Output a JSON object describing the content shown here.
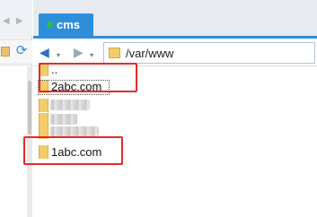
{
  "left_pane": {
    "folder_icon": "folder-icon",
    "refresh_icon": "refresh-icon",
    "refresh_glyph": "⟳"
  },
  "tab": {
    "label": "cms",
    "status_color": "#2fbf3e",
    "accent_color": "#2d8fdc"
  },
  "nav": {
    "back_glyph": "◀",
    "forward_glyph": "▶",
    "dropdown_glyph": "▾",
    "path": "/var/www"
  },
  "files": [
    {
      "name": "..",
      "icon": "folder-icon"
    },
    {
      "name": "2abc.com",
      "icon": "folder-icon"
    },
    {
      "name": "",
      "icon": "folder-icon"
    },
    {
      "name": "",
      "icon": "folder-icon"
    },
    {
      "name": "",
      "icon": "folder-icon"
    },
    {
      "name": "1abc.com",
      "icon": "folder-icon"
    }
  ],
  "annotations": {
    "highlight_color": "#e52a2a"
  }
}
